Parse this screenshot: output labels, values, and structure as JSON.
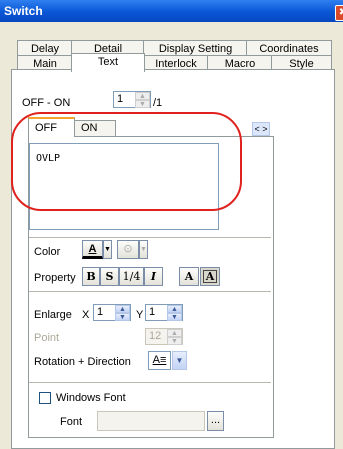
{
  "window": {
    "title": "Switch",
    "close_icon": "✖"
  },
  "tabs_row1": [
    "Delay",
    "Detail",
    "Display Setting",
    "Coordinates"
  ],
  "tabs_row2": [
    "Main",
    "Text",
    "Interlock",
    "Macro",
    "Style"
  ],
  "off_on": {
    "label": "OFF - ON",
    "value": "1",
    "total": "/1"
  },
  "state_tabs": [
    "OFF",
    "ON"
  ],
  "nav_arrows": "< >",
  "text_value": "OVLP",
  "color": {
    "label": "Color",
    "font_color_glyph": "A",
    "back_color_glyph": "⊙"
  },
  "property": {
    "label": "Property",
    "bold": "B",
    "shadow": "S",
    "quarter": "1/4",
    "italic": "I",
    "normal_a": "A",
    "framed_a": "A"
  },
  "enlarge": {
    "label": "Enlarge",
    "x_label": "X",
    "x_value": "1",
    "y_label": "Y",
    "y_value": "1"
  },
  "point": {
    "label": "Point",
    "value": "12"
  },
  "rotation": {
    "label": "Rotation + Direction",
    "glyph": "A≡"
  },
  "windows_font": {
    "checkbox_label": "Windows Font",
    "font_label": "Font",
    "font_value": "",
    "browse_label": "..."
  },
  "colors": {
    "title_bar": "#0a56d6",
    "annotation": "#e0221e",
    "panel": "#ece9d8"
  }
}
